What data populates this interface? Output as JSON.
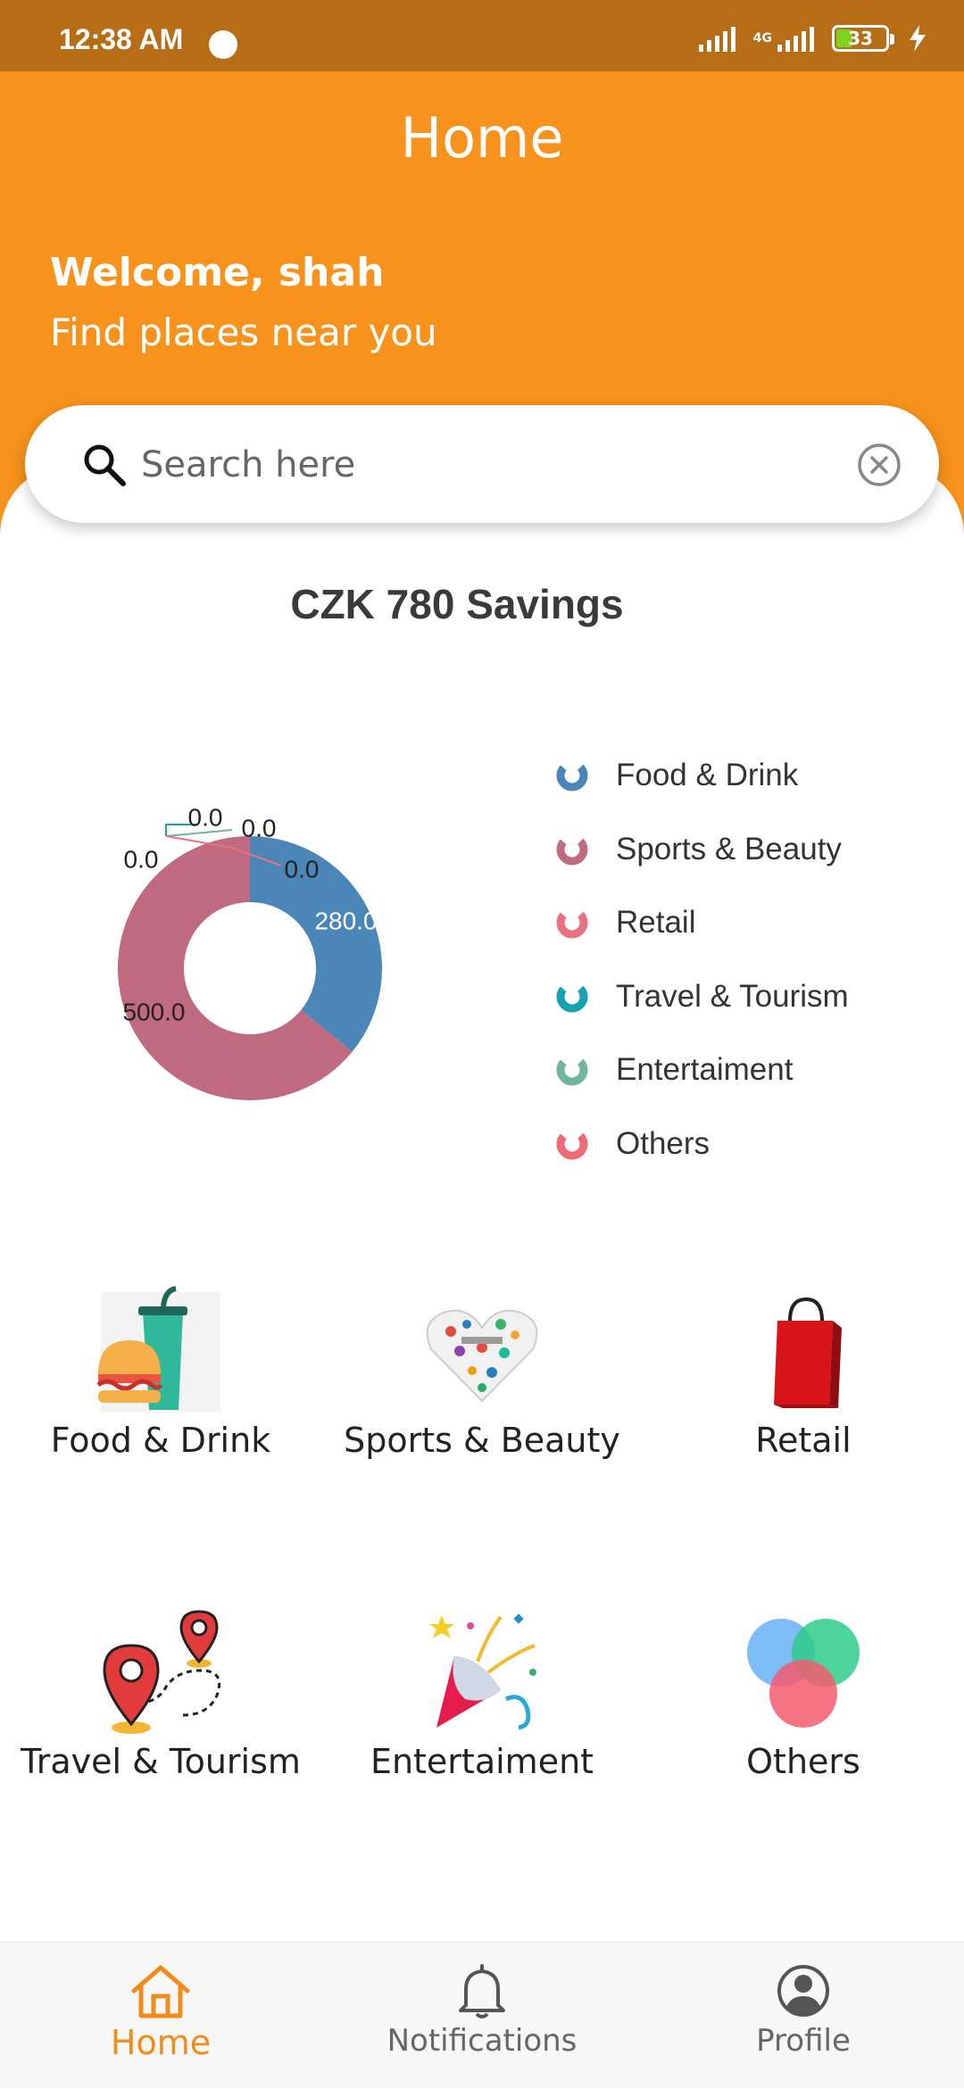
{
  "status_bar": {
    "time": "12:38 AM",
    "network": "4G",
    "battery": "33",
    "battery_level": 0.33
  },
  "header": {
    "title": "Home",
    "welcome": "Welcome, shah",
    "subtitle": "Find places near you"
  },
  "search": {
    "placeholder": "Search here",
    "value": ""
  },
  "savings_title": "CZK 780 Savings",
  "chart_data": {
    "type": "pie",
    "donut": true,
    "categories": [
      "Food & Drink",
      "Sports & Beauty",
      "Retail",
      "Travel & Tourism",
      "Entertaiment",
      "Others"
    ],
    "values": [
      280.0,
      500.0,
      0.0,
      0.0,
      0.0,
      0.0
    ],
    "data_labels": [
      "280.0",
      "500.0",
      "0.0",
      "0.0",
      "0.0",
      "0.0"
    ],
    "colors": [
      "#4a86b8",
      "#c06a80",
      "#e8727f",
      "#17a2b2",
      "#6fb59f",
      "#ee6a74"
    ],
    "legend_position": "right"
  },
  "categories": [
    {
      "label": "Food & Drink",
      "icon": "food-drink-icon"
    },
    {
      "label": "Sports & Beauty",
      "icon": "sports-beauty-icon"
    },
    {
      "label": "Retail",
      "icon": "retail-bag-icon"
    },
    {
      "label": "Travel & Tourism",
      "icon": "travel-pins-icon"
    },
    {
      "label": "Entertaiment",
      "icon": "party-popper-icon"
    },
    {
      "label": "Others",
      "icon": "venn-circles-icon"
    }
  ],
  "bottom_nav": [
    {
      "label": "Home",
      "icon": "home-icon",
      "active": true
    },
    {
      "label": "Notifications",
      "icon": "bell-icon",
      "active": false
    },
    {
      "label": "Profile",
      "icon": "profile-icon",
      "active": false
    }
  ],
  "colors": {
    "header": "#f7921c",
    "status_bar": "#b76d16",
    "accent": "#f08c1a"
  }
}
